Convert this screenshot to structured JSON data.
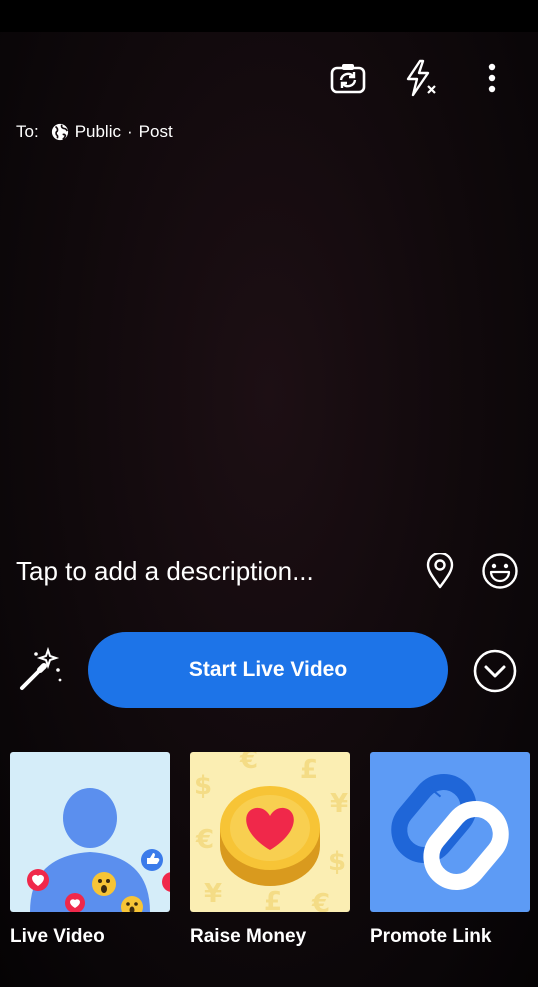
{
  "audience": {
    "to_label": "To:",
    "privacy": "Public",
    "separator": "·",
    "destination": "Post"
  },
  "composer": {
    "description_placeholder": "Tap to add a description..."
  },
  "live": {
    "start_button_label": "Start Live Video"
  },
  "cards": [
    {
      "label": "Live Video"
    },
    {
      "label": "Raise Money"
    },
    {
      "label": "Promote Link"
    }
  ],
  "colors": {
    "primary_blue": "#1d74e8",
    "heart_red": "#f0284a",
    "coin_yellow": "#f7c436"
  },
  "icons": [
    "flip-camera-icon",
    "flash-off-icon",
    "more-options-icon",
    "globe-icon",
    "location-pin-icon",
    "emoji-icon",
    "magic-wand-icon",
    "chevron-down-icon"
  ]
}
